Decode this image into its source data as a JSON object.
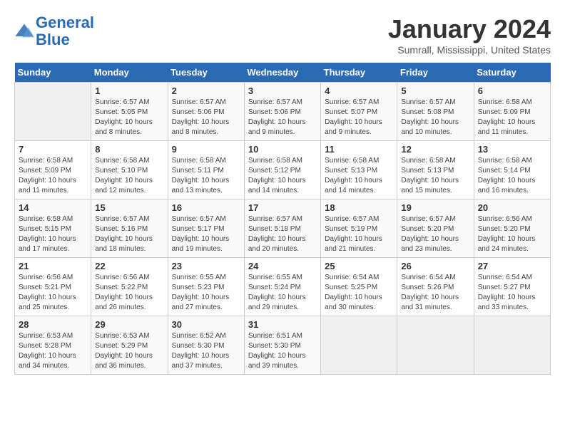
{
  "logo": {
    "text_general": "General",
    "text_blue": "Blue"
  },
  "title": "January 2024",
  "subtitle": "Sumrall, Mississippi, United States",
  "headers": [
    "Sunday",
    "Monday",
    "Tuesday",
    "Wednesday",
    "Thursday",
    "Friday",
    "Saturday"
  ],
  "weeks": [
    [
      {
        "day": "",
        "sunrise": "",
        "sunset": "",
        "daylight": ""
      },
      {
        "day": "1",
        "sunrise": "Sunrise: 6:57 AM",
        "sunset": "Sunset: 5:05 PM",
        "daylight": "Daylight: 10 hours and 8 minutes."
      },
      {
        "day": "2",
        "sunrise": "Sunrise: 6:57 AM",
        "sunset": "Sunset: 5:06 PM",
        "daylight": "Daylight: 10 hours and 8 minutes."
      },
      {
        "day": "3",
        "sunrise": "Sunrise: 6:57 AM",
        "sunset": "Sunset: 5:06 PM",
        "daylight": "Daylight: 10 hours and 9 minutes."
      },
      {
        "day": "4",
        "sunrise": "Sunrise: 6:57 AM",
        "sunset": "Sunset: 5:07 PM",
        "daylight": "Daylight: 10 hours and 9 minutes."
      },
      {
        "day": "5",
        "sunrise": "Sunrise: 6:57 AM",
        "sunset": "Sunset: 5:08 PM",
        "daylight": "Daylight: 10 hours and 10 minutes."
      },
      {
        "day": "6",
        "sunrise": "Sunrise: 6:58 AM",
        "sunset": "Sunset: 5:09 PM",
        "daylight": "Daylight: 10 hours and 11 minutes."
      }
    ],
    [
      {
        "day": "7",
        "sunrise": "Sunrise: 6:58 AM",
        "sunset": "Sunset: 5:09 PM",
        "daylight": "Daylight: 10 hours and 11 minutes."
      },
      {
        "day": "8",
        "sunrise": "Sunrise: 6:58 AM",
        "sunset": "Sunset: 5:10 PM",
        "daylight": "Daylight: 10 hours and 12 minutes."
      },
      {
        "day": "9",
        "sunrise": "Sunrise: 6:58 AM",
        "sunset": "Sunset: 5:11 PM",
        "daylight": "Daylight: 10 hours and 13 minutes."
      },
      {
        "day": "10",
        "sunrise": "Sunrise: 6:58 AM",
        "sunset": "Sunset: 5:12 PM",
        "daylight": "Daylight: 10 hours and 14 minutes."
      },
      {
        "day": "11",
        "sunrise": "Sunrise: 6:58 AM",
        "sunset": "Sunset: 5:13 PM",
        "daylight": "Daylight: 10 hours and 14 minutes."
      },
      {
        "day": "12",
        "sunrise": "Sunrise: 6:58 AM",
        "sunset": "Sunset: 5:13 PM",
        "daylight": "Daylight: 10 hours and 15 minutes."
      },
      {
        "day": "13",
        "sunrise": "Sunrise: 6:58 AM",
        "sunset": "Sunset: 5:14 PM",
        "daylight": "Daylight: 10 hours and 16 minutes."
      }
    ],
    [
      {
        "day": "14",
        "sunrise": "Sunrise: 6:58 AM",
        "sunset": "Sunset: 5:15 PM",
        "daylight": "Daylight: 10 hours and 17 minutes."
      },
      {
        "day": "15",
        "sunrise": "Sunrise: 6:57 AM",
        "sunset": "Sunset: 5:16 PM",
        "daylight": "Daylight: 10 hours and 18 minutes."
      },
      {
        "day": "16",
        "sunrise": "Sunrise: 6:57 AM",
        "sunset": "Sunset: 5:17 PM",
        "daylight": "Daylight: 10 hours and 19 minutes."
      },
      {
        "day": "17",
        "sunrise": "Sunrise: 6:57 AM",
        "sunset": "Sunset: 5:18 PM",
        "daylight": "Daylight: 10 hours and 20 minutes."
      },
      {
        "day": "18",
        "sunrise": "Sunrise: 6:57 AM",
        "sunset": "Sunset: 5:19 PM",
        "daylight": "Daylight: 10 hours and 21 minutes."
      },
      {
        "day": "19",
        "sunrise": "Sunrise: 6:57 AM",
        "sunset": "Sunset: 5:20 PM",
        "daylight": "Daylight: 10 hours and 23 minutes."
      },
      {
        "day": "20",
        "sunrise": "Sunrise: 6:56 AM",
        "sunset": "Sunset: 5:20 PM",
        "daylight": "Daylight: 10 hours and 24 minutes."
      }
    ],
    [
      {
        "day": "21",
        "sunrise": "Sunrise: 6:56 AM",
        "sunset": "Sunset: 5:21 PM",
        "daylight": "Daylight: 10 hours and 25 minutes."
      },
      {
        "day": "22",
        "sunrise": "Sunrise: 6:56 AM",
        "sunset": "Sunset: 5:22 PM",
        "daylight": "Daylight: 10 hours and 26 minutes."
      },
      {
        "day": "23",
        "sunrise": "Sunrise: 6:55 AM",
        "sunset": "Sunset: 5:23 PM",
        "daylight": "Daylight: 10 hours and 27 minutes."
      },
      {
        "day": "24",
        "sunrise": "Sunrise: 6:55 AM",
        "sunset": "Sunset: 5:24 PM",
        "daylight": "Daylight: 10 hours and 29 minutes."
      },
      {
        "day": "25",
        "sunrise": "Sunrise: 6:54 AM",
        "sunset": "Sunset: 5:25 PM",
        "daylight": "Daylight: 10 hours and 30 minutes."
      },
      {
        "day": "26",
        "sunrise": "Sunrise: 6:54 AM",
        "sunset": "Sunset: 5:26 PM",
        "daylight": "Daylight: 10 hours and 31 minutes."
      },
      {
        "day": "27",
        "sunrise": "Sunrise: 6:54 AM",
        "sunset": "Sunset: 5:27 PM",
        "daylight": "Daylight: 10 hours and 33 minutes."
      }
    ],
    [
      {
        "day": "28",
        "sunrise": "Sunrise: 6:53 AM",
        "sunset": "Sunset: 5:28 PM",
        "daylight": "Daylight: 10 hours and 34 minutes."
      },
      {
        "day": "29",
        "sunrise": "Sunrise: 6:53 AM",
        "sunset": "Sunset: 5:29 PM",
        "daylight": "Daylight: 10 hours and 36 minutes."
      },
      {
        "day": "30",
        "sunrise": "Sunrise: 6:52 AM",
        "sunset": "Sunset: 5:30 PM",
        "daylight": "Daylight: 10 hours and 37 minutes."
      },
      {
        "day": "31",
        "sunrise": "Sunrise: 6:51 AM",
        "sunset": "Sunset: 5:30 PM",
        "daylight": "Daylight: 10 hours and 39 minutes."
      },
      {
        "day": "",
        "sunrise": "",
        "sunset": "",
        "daylight": ""
      },
      {
        "day": "",
        "sunrise": "",
        "sunset": "",
        "daylight": ""
      },
      {
        "day": "",
        "sunrise": "",
        "sunset": "",
        "daylight": ""
      }
    ]
  ]
}
